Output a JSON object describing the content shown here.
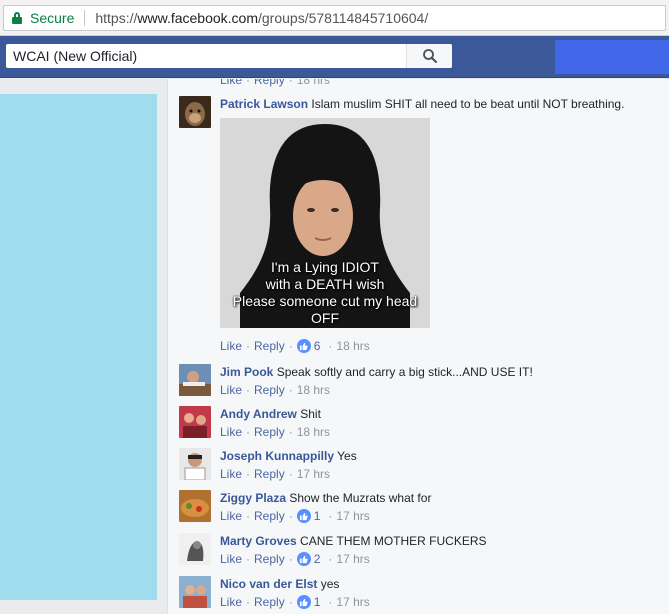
{
  "browser": {
    "secure_label": "Secure",
    "url_prefix": "https://",
    "url_host": "www.facebook.com",
    "url_path": "/groups/578114845710604/"
  },
  "search": {
    "value": "WCAI (New Official)"
  },
  "top_actions": {
    "like": "Like",
    "reply": "Reply",
    "time": "18 hrs"
  },
  "meme": {
    "caption_lines": [
      "I'm a Lying IDIOT",
      "with a DEATH wish",
      "Please someone cut my head",
      "OFF"
    ]
  },
  "comments": [
    {
      "author": "Patrick Lawson",
      "text": "Islam muslim SHIT all need to be beat until NOT breathing.",
      "like": "Like",
      "reply": "Reply",
      "likes": "6",
      "time": "18 hrs"
    },
    {
      "author": "Jim Pook",
      "text": "Speak softly and carry a big stick...AND USE IT!",
      "like": "Like",
      "reply": "Reply",
      "likes": "",
      "time": "18 hrs"
    },
    {
      "author": "Andy Andrew",
      "text": "Shit",
      "like": "Like",
      "reply": "Reply",
      "likes": "",
      "time": "18 hrs"
    },
    {
      "author": "Joseph Kunnappilly",
      "text": "Yes",
      "like": "Like",
      "reply": "Reply",
      "likes": "",
      "time": "17 hrs"
    },
    {
      "author": "Ziggy Plaza",
      "text": "Show the Muzrats what for",
      "like": "Like",
      "reply": "Reply",
      "likes": "1",
      "time": "17 hrs"
    },
    {
      "author": "Marty Groves",
      "text": "CANE THEM MOTHER FUCKERS",
      "like": "Like",
      "reply": "Reply",
      "likes": "2",
      "time": "17 hrs"
    },
    {
      "author": "Nico van der Elst",
      "text": "yes",
      "like": "Like",
      "reply": "Reply",
      "likes": "1",
      "time": "17 hrs"
    }
  ],
  "colors": {
    "fb_blue": "#3b5998",
    "link_blue": "#385898",
    "like_blue": "#5890ff",
    "secure_green": "#0b8043",
    "panel_cyan": "#9fdcee"
  }
}
